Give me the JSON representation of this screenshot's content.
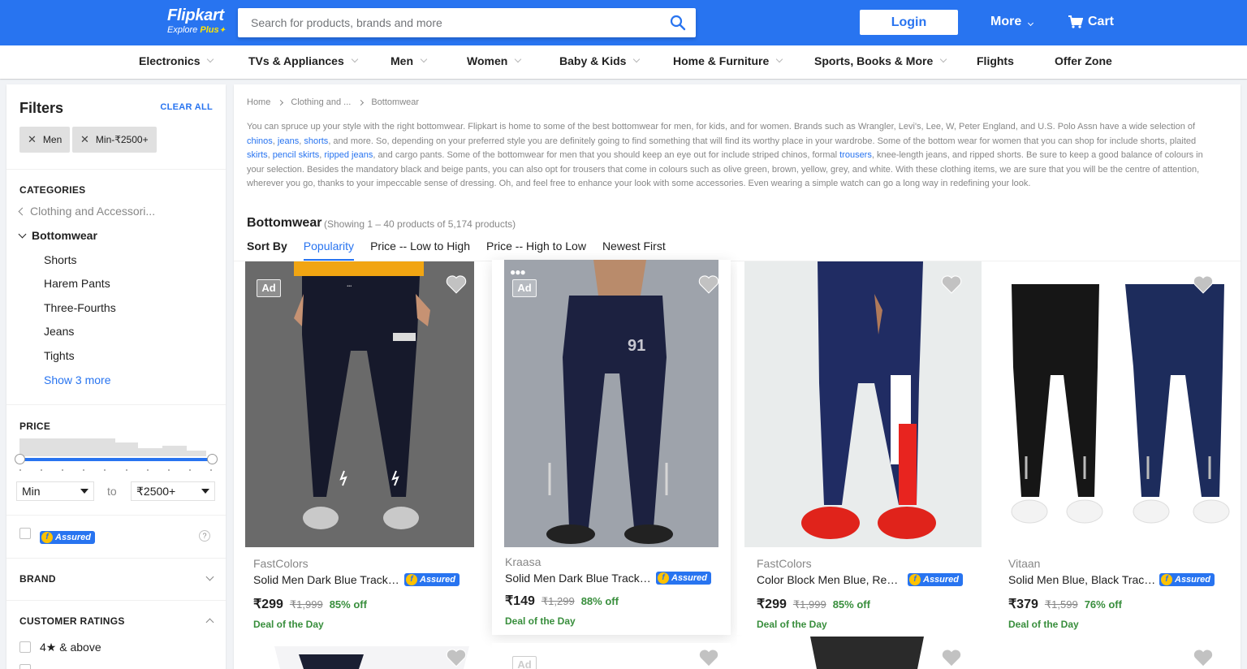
{
  "header": {
    "logo_brand": "Flipkart",
    "logo_tag_prefix": "Explore",
    "logo_tag_plus": "Plus",
    "search_placeholder": "Search for products, brands and more",
    "login_label": "Login",
    "more_label": "More",
    "cart_label": "Cart",
    "brand_color": "#2874f0"
  },
  "catnav": [
    {
      "label": "Electronics",
      "has_menu": true
    },
    {
      "label": "TVs & Appliances",
      "has_menu": true
    },
    {
      "label": "Men",
      "has_menu": true
    },
    {
      "label": "Women",
      "has_menu": true
    },
    {
      "label": "Baby & Kids",
      "has_menu": true
    },
    {
      "label": "Home & Furniture",
      "has_menu": true
    },
    {
      "label": "Sports, Books & More",
      "has_menu": true
    },
    {
      "label": "Flights",
      "has_menu": false
    },
    {
      "label": "Offer Zone",
      "has_menu": false
    }
  ],
  "filters": {
    "title": "Filters",
    "clear_all": "CLEAR ALL",
    "chips": [
      "Men",
      "Min-₹2500+"
    ],
    "categories_heading": "CATEGORIES",
    "parent_category": "Clothing and Accessori...",
    "current_category": "Bottomwear",
    "subcategories": [
      "Shorts",
      "Harem Pants",
      "Three-Fourths",
      "Jeans",
      "Tights"
    ],
    "show_more": "Show 3 more",
    "price_heading": "PRICE",
    "price_min": "Min",
    "price_to": "to",
    "price_max": "₹2500+",
    "assured_label": "Assured",
    "assured_help": "?",
    "brand_heading": "BRAND",
    "ratings_heading": "CUSTOMER RATINGS",
    "rating_option": "4★ & above"
  },
  "main": {
    "breadcrumb": [
      "Home",
      "Clothing and ...",
      "Bottomwear"
    ],
    "description_parts": [
      {
        "t": "You can spruce up your style with the right bottomwear. Flipkart is home to some of the best bottomwear for men, for kids, and for women. Brands such as Wrangler, Levi's, Lee, W, Peter England, and U.S. Polo Assn have a wide selection of "
      },
      {
        "t": "chinos",
        "link": true
      },
      {
        "t": ", "
      },
      {
        "t": "jeans",
        "link": true
      },
      {
        "t": ", "
      },
      {
        "t": "shorts",
        "link": true
      },
      {
        "t": ", and more. So, depending on your preferred style you are definitely going to find something that will find its worthy place in your wardrobe. Some of the bottom wear for women that you can shop for include shorts, plaited "
      },
      {
        "t": "skirts",
        "link": true
      },
      {
        "t": ", "
      },
      {
        "t": "pencil skirts",
        "link": true
      },
      {
        "t": ", "
      },
      {
        "t": "ripped jeans",
        "link": true
      },
      {
        "t": ", and cargo pants. Some of the bottomwear for men that you should keep an eye out for include striped chinos, formal "
      },
      {
        "t": "trousers",
        "link": true
      },
      {
        "t": ", knee-length jeans, and ripped shorts. Be sure to keep a good balance of colours in your selection. Besides the mandatory black and beige pants, you can also opt for trousers that come in colours such as olive green, brown, yellow, grey, and white. With these clothing items, we are sure that you will be the centre of attention, wherever you go, thanks to your impeccable sense of dressing. Oh, and feel free to enhance your look with some accessories. Even wearing a simple watch can go a long way in redefining your look."
      }
    ],
    "title": "Bottomwear",
    "showing": "(Showing 1 – 40 products of 5,174 products)",
    "sort_label": "Sort By",
    "sort_options": [
      "Popularity",
      "Price -- Low to High",
      "Price -- High to Low",
      "Newest First"
    ],
    "sort_active": "Popularity"
  },
  "products": [
    {
      "brand": "FastColors",
      "name": "Solid Men Dark Blue Track P...",
      "price": "₹299",
      "mrp": "₹1,999",
      "off": "85% off",
      "deal": "Deal of the Day",
      "ad": "Ad",
      "assured": "Assured"
    },
    {
      "brand": "Kraasa",
      "name": "Solid Men Dark Blue Track P...",
      "price": "₹149",
      "mrp": "₹1,299",
      "off": "88% off",
      "deal": "Deal of the Day",
      "ad": "Ad",
      "assured": "Assured"
    },
    {
      "brand": "FastColors",
      "name": "Color Block Men Blue, Red T...",
      "price": "₹299",
      "mrp": "₹1,999",
      "off": "85% off",
      "deal": "Deal of the Day",
      "ad": "",
      "assured": "Assured"
    },
    {
      "brand": "Vitaan",
      "name": "Solid Men Blue, Black Track ...",
      "price": "₹379",
      "mrp": "₹1,599",
      "off": "76% off",
      "deal": "Deal of the Day",
      "ad": "",
      "assured": "Assured"
    }
  ],
  "next_row": {
    "ad": "Ad"
  }
}
